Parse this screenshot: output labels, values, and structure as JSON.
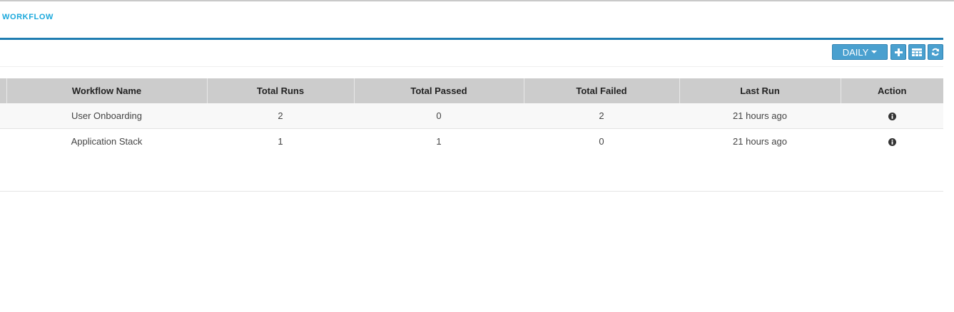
{
  "page": {
    "title": "WORKFLOW"
  },
  "toolbar": {
    "period_label": "DAILY",
    "add_icon": "plus-icon",
    "columns_icon": "table-columns-icon",
    "refresh_icon": "refresh-icon",
    "button_color": "#4aa0cf"
  },
  "table": {
    "headers": {
      "workflow_name": "Workflow Name",
      "total_runs": "Total Runs",
      "total_passed": "Total Passed",
      "total_failed": "Total Failed",
      "last_run": "Last Run",
      "action": "Action"
    },
    "rows": [
      {
        "workflow_name": "User Onboarding",
        "total_runs": "2",
        "total_passed": "0",
        "total_failed": "2",
        "last_run": "21 hours ago",
        "action_icon": "info-circle-icon"
      },
      {
        "workflow_name": "Application Stack",
        "total_runs": "1",
        "total_passed": "1",
        "total_failed": "0",
        "last_run": "21 hours ago",
        "action_icon": "info-circle-icon"
      }
    ]
  },
  "colors": {
    "accent": "#1aa8dc",
    "panel_border": "#1f7db1",
    "header_bg": "#cccccc"
  }
}
